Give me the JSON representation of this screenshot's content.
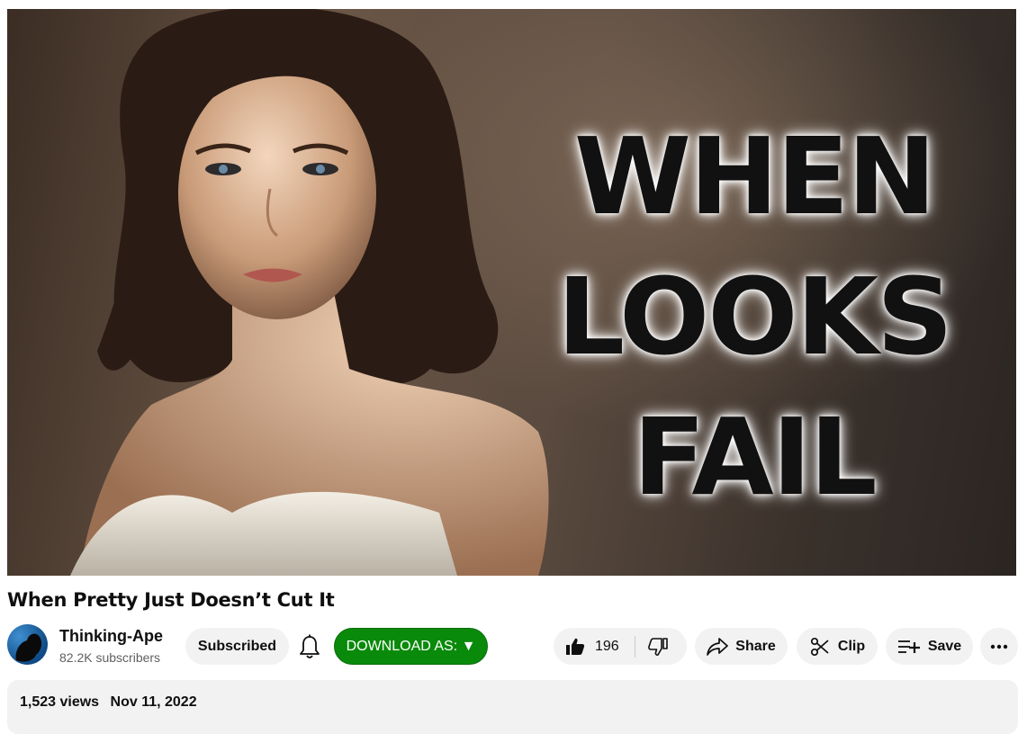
{
  "player": {
    "thumbnail_text": [
      "WHEN",
      "LOOKS",
      "FAIL"
    ]
  },
  "video": {
    "title": "When Pretty Just Doesn’t Cut It"
  },
  "channel": {
    "name": "Thinking-Ape",
    "subscribers": "82.2K subscribers"
  },
  "actions": {
    "subscribed_label": "Subscribed",
    "download_label": "DOWNLOAD AS: ▼",
    "like_count": "196",
    "share_label": "Share",
    "clip_label": "Clip",
    "save_label": "Save"
  },
  "description": {
    "views": "1,523 views",
    "date": "Nov 11, 2022"
  },
  "icons": [
    "like-icon",
    "dislike-icon",
    "share-icon",
    "clip-icon",
    "save-icon",
    "more-icon",
    "bell-icon"
  ],
  "colors": {
    "download_button": "#0a8a0a",
    "pill_background": "#f2f2f2"
  }
}
